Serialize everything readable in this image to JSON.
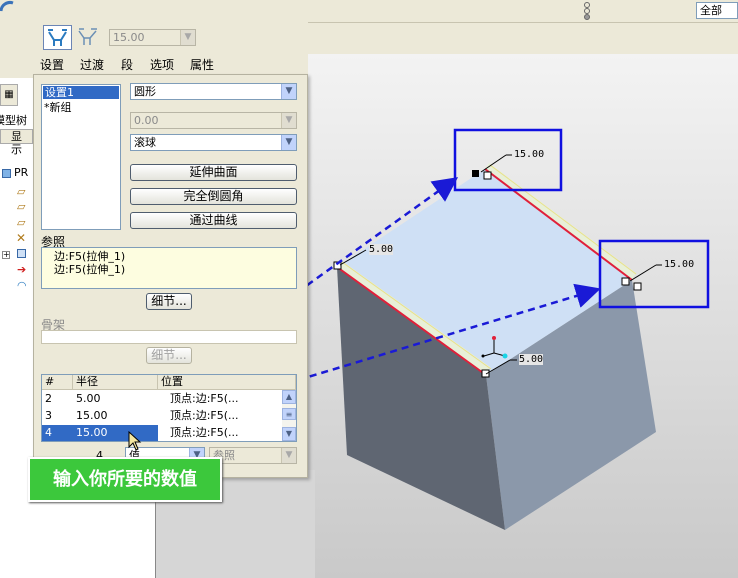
{
  "toolbar": {
    "radius_value": "15.00",
    "filter_value": "全部"
  },
  "tabs": [
    "设置",
    "过渡",
    "段",
    "选项",
    "属性"
  ],
  "model_tree": {
    "tab_label": "模型树",
    "show_label": "显示",
    "root_label": "PR"
  },
  "sets": {
    "items": [
      "设置1",
      "*新组"
    ]
  },
  "settings": {
    "shape": "圆形",
    "conic_value": "0.00",
    "method": "滚球",
    "buttons": [
      "延伸曲面",
      "完全倒圆角",
      "通过曲线"
    ]
  },
  "references": {
    "label": "参照",
    "items": [
      "边:F5(拉伸_1)",
      "边:F5(拉伸_1)"
    ],
    "details_button": "细节..."
  },
  "skeleton": {
    "label": "骨架",
    "details_button": "细节..."
  },
  "radius_table": {
    "headers": [
      "#",
      "半径",
      "位置"
    ],
    "rows": [
      {
        "num": "2",
        "radius": "5.00",
        "position": "顶点:边:F5(..."
      },
      {
        "num": "3",
        "radius": "15.00",
        "position": "顶点:边:F5(..."
      },
      {
        "num": "4",
        "radius": "15.00",
        "position": "顶点:边:F5(..."
      }
    ],
    "footer_value": "值",
    "footer_ref": "参照",
    "footer_num": "4"
  },
  "annotation": {
    "callout_text": "输入你所要的数值",
    "highlight_color": "#1010e0",
    "arrow_color": "#1a1ad6"
  },
  "model_dims": {
    "top_corner": "15.00",
    "right_corner": "15.00",
    "left_corner": "5.00",
    "front_corner": "5.00"
  }
}
